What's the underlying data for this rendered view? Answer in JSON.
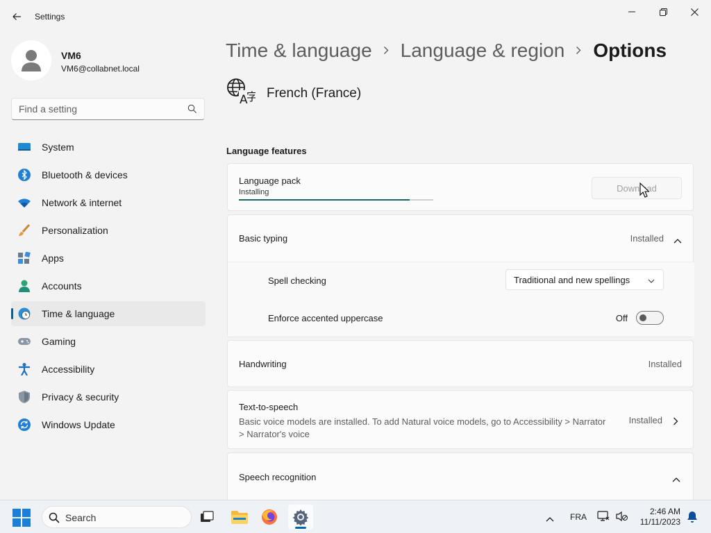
{
  "window": {
    "title": "Settings"
  },
  "user": {
    "name": "VM6",
    "email": "VM6@collabnet.local"
  },
  "search": {
    "placeholder": "Find a setting"
  },
  "sidebar": {
    "items": [
      {
        "label": "System",
        "icon": "system-icon"
      },
      {
        "label": "Bluetooth & devices",
        "icon": "bluetooth-icon"
      },
      {
        "label": "Network & internet",
        "icon": "wifi-icon"
      },
      {
        "label": "Personalization",
        "icon": "brush-icon"
      },
      {
        "label": "Apps",
        "icon": "apps-icon"
      },
      {
        "label": "Accounts",
        "icon": "accounts-icon"
      },
      {
        "label": "Time & language",
        "icon": "time-language-icon",
        "active": true
      },
      {
        "label": "Gaming",
        "icon": "gamepad-icon"
      },
      {
        "label": "Accessibility",
        "icon": "accessibility-icon"
      },
      {
        "label": "Privacy & security",
        "icon": "shield-icon"
      },
      {
        "label": "Windows Update",
        "icon": "update-icon"
      }
    ]
  },
  "breadcrumb": {
    "part1": "Time & language",
    "part2": "Language & region",
    "current": "Options"
  },
  "language": {
    "name": "French (France)"
  },
  "features": {
    "section_title": "Language features",
    "language_pack": {
      "label": "Language pack",
      "status": "Installing",
      "progress": 0.88,
      "button": "Download"
    },
    "basic_typing": {
      "label": "Basic typing",
      "status": "Installed"
    },
    "spell_checking": {
      "label": "Spell checking",
      "value": "Traditional and new spellings"
    },
    "enforce_accented": {
      "label": "Enforce accented uppercase",
      "state": "Off"
    },
    "handwriting": {
      "label": "Handwriting",
      "status": "Installed"
    },
    "tts": {
      "label": "Text-to-speech",
      "description": "Basic voice models are installed. To add Natural voice models, go to Accessibility > Narrator > Narrator's voice",
      "status": "Installed"
    },
    "speech_recognition": {
      "label": "Speech recognition"
    }
  },
  "taskbar": {
    "search_label": "Search",
    "input_language": "FRA",
    "time": "2:46 AM",
    "date": "11/11/2023"
  },
  "colors": {
    "accent": "#0067c0",
    "progress": "#0f6a60",
    "nav_indicator": "#0a5e8c"
  }
}
